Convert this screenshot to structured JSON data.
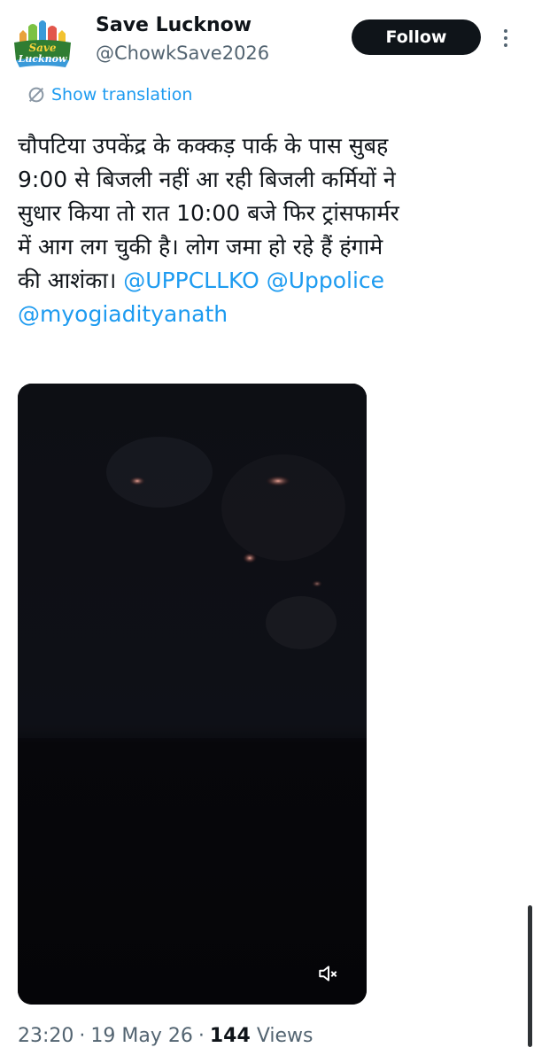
{
  "account": {
    "name": "Save Lucknow",
    "handle": "@ChowkSave2026",
    "avatar_text_top": "Save",
    "avatar_text_bottom": "Lucknow",
    "avatar_icon": "save-lucknow-logo"
  },
  "actions": {
    "follow_label": "Follow",
    "more_icon": "more-vertical-icon"
  },
  "translation": {
    "label": "Show translation",
    "icon": "translate-icon"
  },
  "tweet": {
    "lines": [
      "चौपटिया उपकेंद्र के कक्कड़ पार्क के पास सुबह",
      "9:00 से बिजली नहीं आ रही बिजली कर्मियों ने",
      "सुधार किया तो रात 10:00 बजे फिर ट्रांसफार्मर",
      "में आग लग चुकी है। लोग जमा हो रहे हैं हंगामे"
    ],
    "line5_text": "की आशंका। ",
    "mention1": "@UPPCLLKO",
    "mention2": "@Uppolice",
    "mention3": "@myogiadityanath"
  },
  "video": {
    "mute_icon": "speaker-muted-icon"
  },
  "meta": {
    "time": "23:20",
    "date": "19 May 26",
    "separator": "·",
    "views_count": "144",
    "views_label": "Views"
  },
  "colors": {
    "accent": "#1d9bf0",
    "text_primary": "#0f1419",
    "text_secondary": "#536471",
    "follow_bg": "#0f1419",
    "video_bg": "#06060a"
  }
}
